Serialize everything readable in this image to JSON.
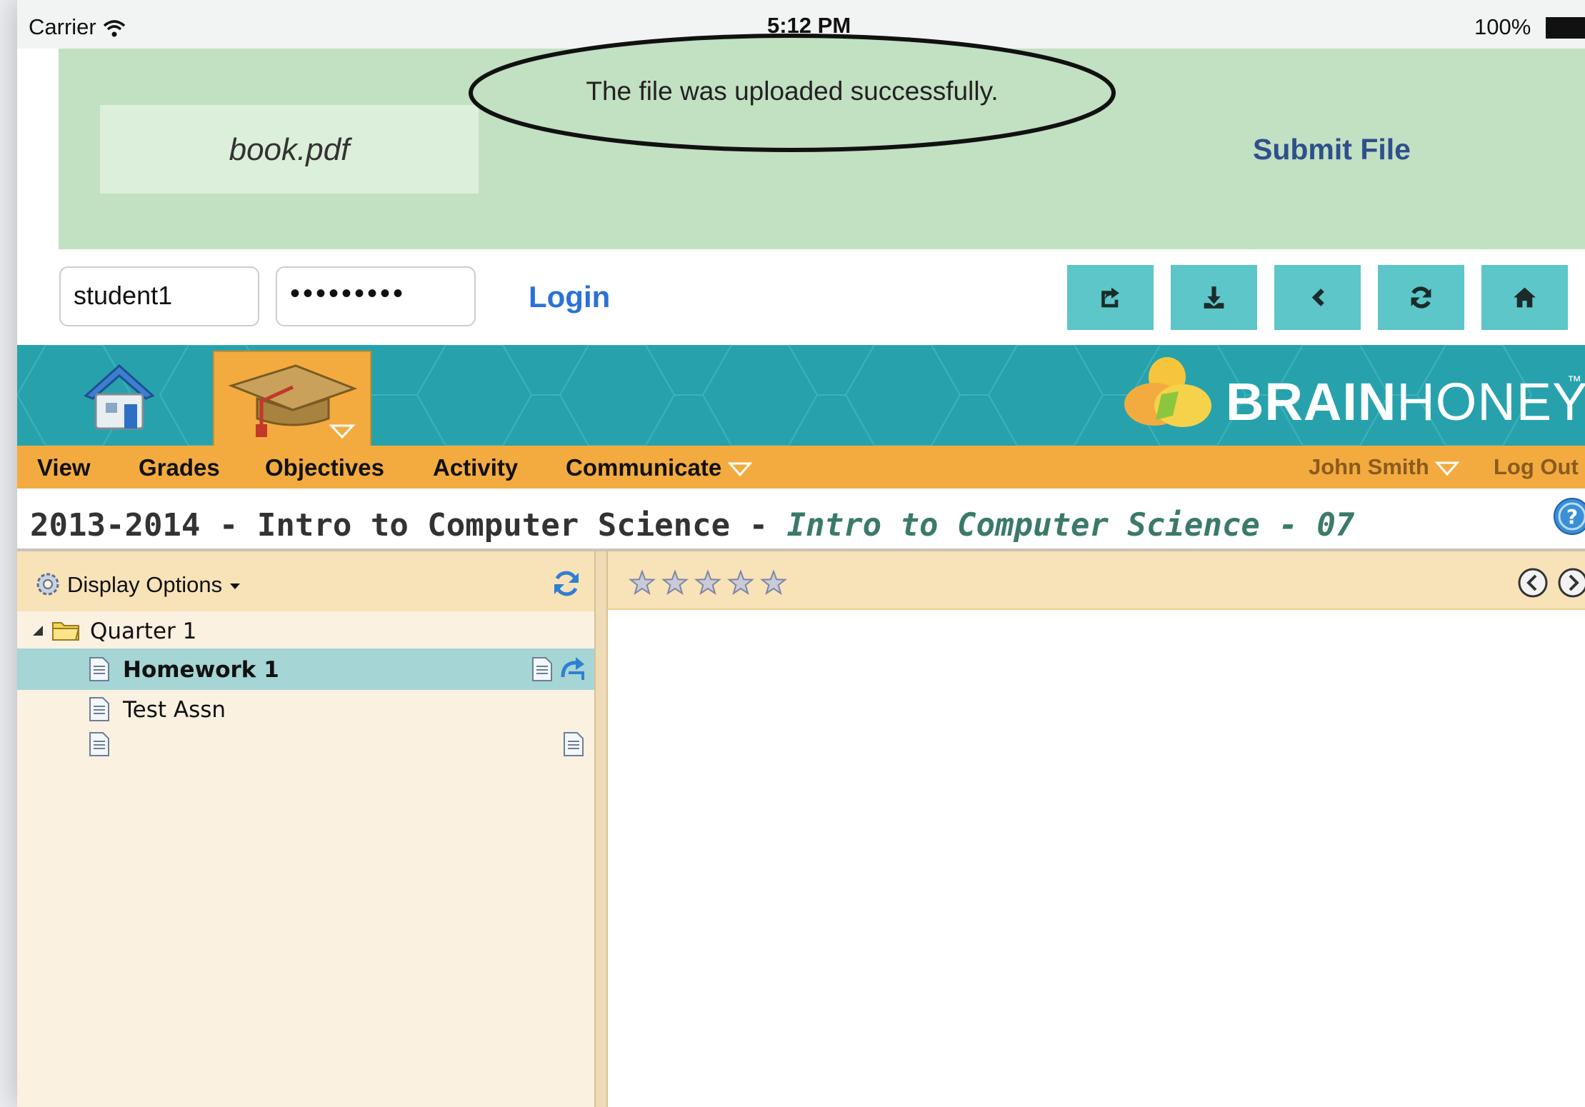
{
  "status_bar": {
    "carrier": "Carrier",
    "time": "5:12 PM",
    "battery": "100%"
  },
  "upload": {
    "file_name": "book.pdf",
    "submit_label": "Submit File",
    "message": "The file was uploaded successfully."
  },
  "login": {
    "username": "student1",
    "password_mask": "•••••••••",
    "login_label": "Login"
  },
  "toolbar_icons": [
    "share-icon",
    "download-icon",
    "back-icon",
    "refresh-icon",
    "home-icon"
  ],
  "brand": {
    "bold": "BRAIN",
    "light": "HONEY",
    "tm": "™"
  },
  "nav": {
    "items": [
      "View",
      "Grades",
      "Objectives",
      "Activity",
      "Communicate"
    ],
    "user": "John Smith",
    "logout": "Log Out"
  },
  "course": {
    "prefix": "2013-2014 - Intro to Computer Science - ",
    "section": "Intro to Computer Science - 07"
  },
  "left_panel": {
    "display_options": "Display Options",
    "tree": [
      {
        "label": "Quarter 1",
        "type": "folder"
      },
      {
        "label": "Homework 1",
        "type": "item",
        "selected": true
      },
      {
        "label": "Test Assn",
        "type": "item"
      },
      {
        "label": "",
        "type": "item"
      }
    ]
  },
  "right_panel": {
    "rating_stars": 5
  },
  "colors": {
    "banner": "#c2e0c2",
    "toolbar_button": "#5cc6c8",
    "brand_teal": "#27a2ac",
    "nav_orange": "#f3ab3f",
    "selected_row": "#a5d5d4"
  }
}
